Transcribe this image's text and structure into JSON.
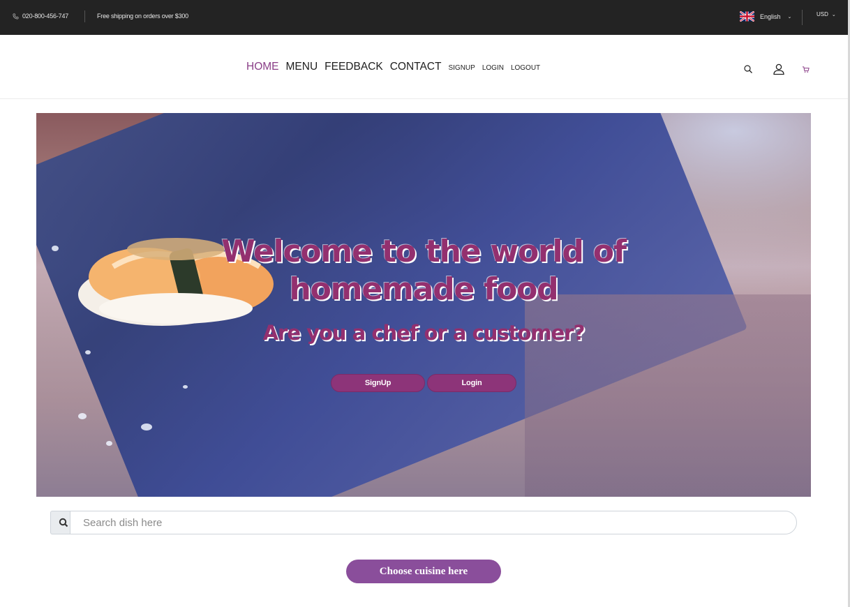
{
  "topbar": {
    "phone": "020-800-456-747",
    "shipping": "Free shipping on orders over $300",
    "language": "English",
    "currency": "USD"
  },
  "nav": {
    "items": [
      {
        "label": "HOME",
        "size": "big",
        "active": true
      },
      {
        "label": "MENU",
        "size": "big"
      },
      {
        "label": "FEEDBACK",
        "size": "big"
      },
      {
        "label": "CONTACT",
        "size": "big"
      },
      {
        "label": "SIGNUP",
        "size": "small"
      },
      {
        "label": "LOGIN",
        "size": "small"
      },
      {
        "label": "LOGOUT",
        "size": "small"
      }
    ],
    "icons": [
      "search-icon",
      "user-icon",
      "cart-icon"
    ]
  },
  "hero": {
    "title_line1": "Welcome to the world of",
    "title_line2": "homemade food",
    "subtitle": "Are you a chef or a customer?",
    "signup_label": "SignUp",
    "login_label": "Login"
  },
  "search": {
    "placeholder": "Search dish here",
    "value": ""
  },
  "cuisine_button": "Choose cuisine here",
  "colors": {
    "accent": "#93306f",
    "button": "#8d3479",
    "cuisine_button": "#8a4e9b",
    "topbar": "#232323"
  }
}
